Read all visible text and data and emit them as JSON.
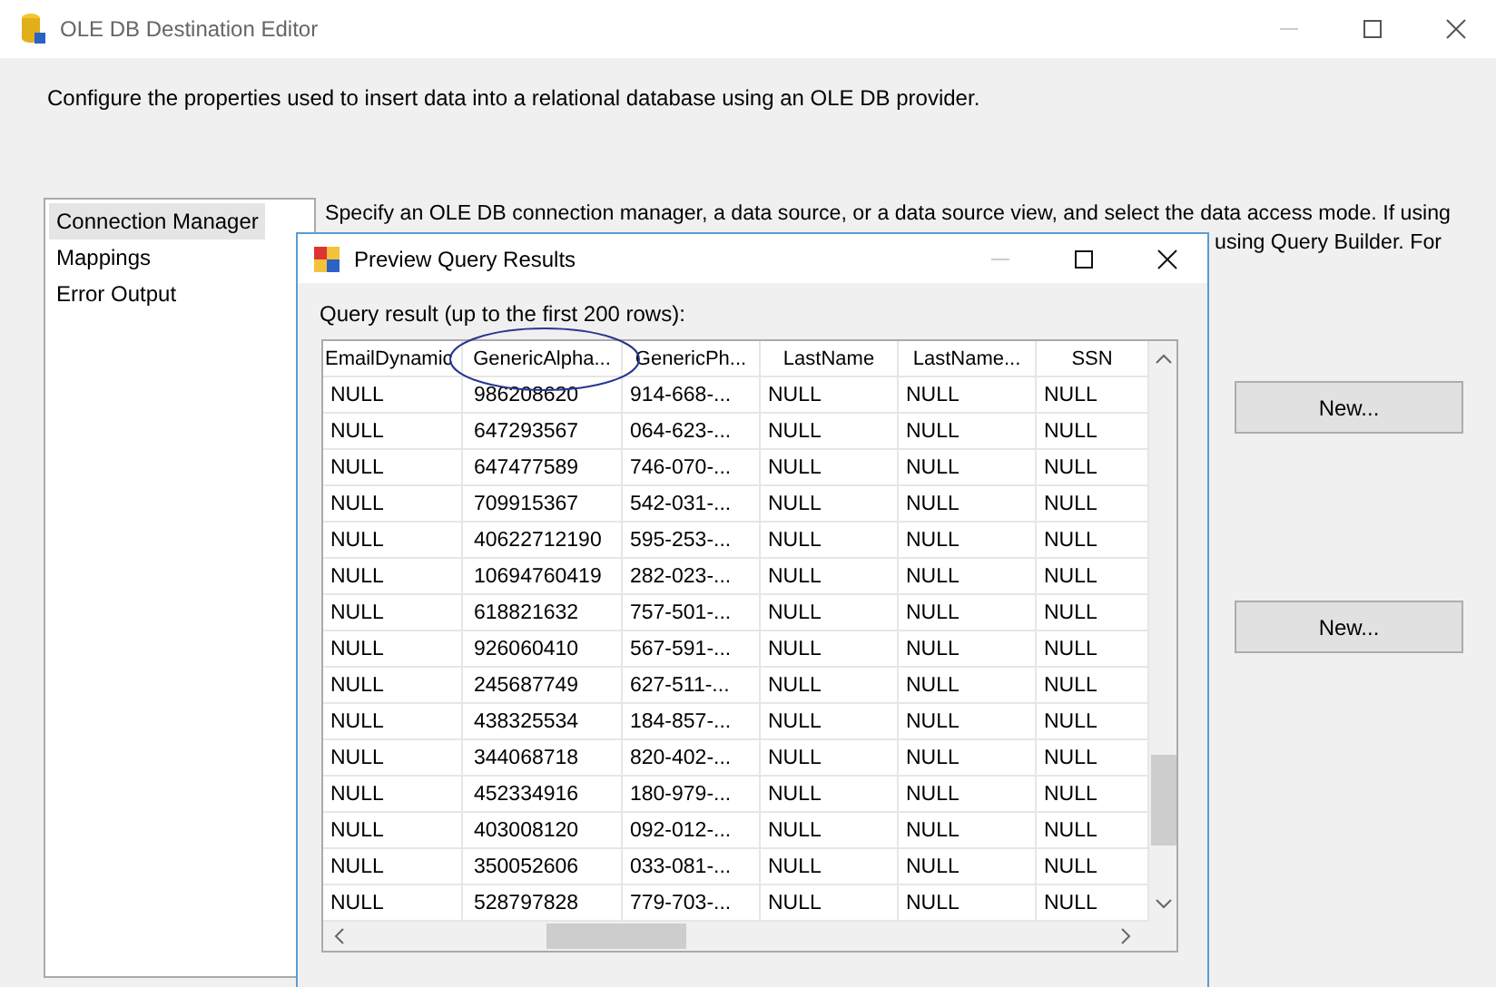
{
  "window": {
    "title": "OLE DB Destination Editor"
  },
  "description": "Configure the properties used to insert data into a relational database using an OLE DB provider.",
  "sidebar": {
    "items": [
      {
        "label": "Connection Manager",
        "selected": true
      },
      {
        "label": "Mappings",
        "selected": false
      },
      {
        "label": "Error Output",
        "selected": false
      }
    ]
  },
  "page_text": [
    "Specify an OLE DB connection manager, a data source, or a data source view, and select the data access mode. If using",
    "using Query Builder. For"
  ],
  "buttons": [
    "New...",
    "New..."
  ],
  "preview": {
    "title": "Preview Query Results",
    "caption": "Query result (up to the first 200 rows):",
    "columns": [
      "EmailDynamic",
      "GenericAlpha...",
      "GenericPh...",
      "LastName",
      "LastName...",
      "SSN"
    ],
    "rows": [
      [
        "NULL",
        "986208620",
        "914-668-...",
        "NULL",
        "NULL",
        "NULL"
      ],
      [
        "NULL",
        "647293567",
        "064-623-...",
        "NULL",
        "NULL",
        "NULL"
      ],
      [
        "NULL",
        "647477589",
        "746-070-...",
        "NULL",
        "NULL",
        "NULL"
      ],
      [
        "NULL",
        "709915367",
        "542-031-...",
        "NULL",
        "NULL",
        "NULL"
      ],
      [
        "NULL",
        "40622712190",
        "595-253-...",
        "NULL",
        "NULL",
        "NULL"
      ],
      [
        "NULL",
        "10694760419",
        "282-023-...",
        "NULL",
        "NULL",
        "NULL"
      ],
      [
        "NULL",
        "618821632",
        "757-501-...",
        "NULL",
        "NULL",
        "NULL"
      ],
      [
        "NULL",
        "926060410",
        "567-591-...",
        "NULL",
        "NULL",
        "NULL"
      ],
      [
        "NULL",
        "245687749",
        "627-511-...",
        "NULL",
        "NULL",
        "NULL"
      ],
      [
        "NULL",
        "438325534",
        "184-857-...",
        "NULL",
        "NULL",
        "NULL"
      ],
      [
        "NULL",
        "344068718",
        "820-402-...",
        "NULL",
        "NULL",
        "NULL"
      ],
      [
        "NULL",
        "452334916",
        "180-979-...",
        "NULL",
        "NULL",
        "NULL"
      ],
      [
        "NULL",
        "403008120",
        "092-012-...",
        "NULL",
        "NULL",
        "NULL"
      ],
      [
        "NULL",
        "350052606",
        "033-081-...",
        "NULL",
        "NULL",
        "NULL"
      ],
      [
        "NULL",
        "528797828",
        "779-703-...",
        "NULL",
        "NULL",
        "NULL"
      ]
    ]
  }
}
